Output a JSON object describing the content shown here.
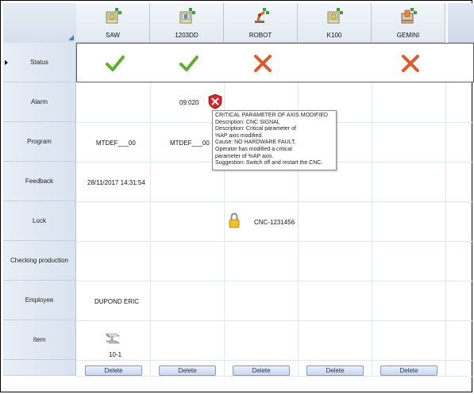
{
  "columns": [
    {
      "name": "SAW",
      "icon": "machine-saw-icon"
    },
    {
      "name": "1203DD",
      "icon": "machine-drill-icon"
    },
    {
      "name": "ROBOT",
      "icon": "robot-arm-icon"
    },
    {
      "name": "K100",
      "icon": "machine-k100-icon"
    },
    {
      "name": "GEMINI",
      "icon": "machine-gemini-icon"
    }
  ],
  "rows": [
    "Status",
    "Alarm",
    "Program",
    "Feedback",
    "Lock",
    "Checking production",
    "Employee",
    "Item"
  ],
  "status": [
    "ok",
    "ok",
    "error",
    "none",
    "error"
  ],
  "alarm": {
    "code": "09:020"
  },
  "program": {
    "saw": "MTDEF___00",
    "dd": "MTDEF___00"
  },
  "feedback": {
    "saw": "28/11/2017 14:31:54"
  },
  "lock": {
    "robot": "CNC-1231456"
  },
  "employee": {
    "saw": "DUPOND ERIC"
  },
  "item": {
    "saw": "10-1"
  },
  "delete_label": "Delete",
  "tooltip": {
    "title": "CRITICAL PARAMETER OF AXIS MODIFIED",
    "lines": [
      "Description:    CNC SIGNAL",
      "Description:    Critical parameter of",
      "%AP axis modified.",
      "Cause:           NO HARDWARE FAULT.",
      "Operator has modified a critical",
      "parameter of %AP axis.",
      "Suggestion:     Switch off and restart the CNC."
    ]
  },
  "colors": {
    "ok": "#5fae2e",
    "error": "#e0592a",
    "header_bg": "#dbe4f0",
    "button_border": "#7f9dc9"
  }
}
